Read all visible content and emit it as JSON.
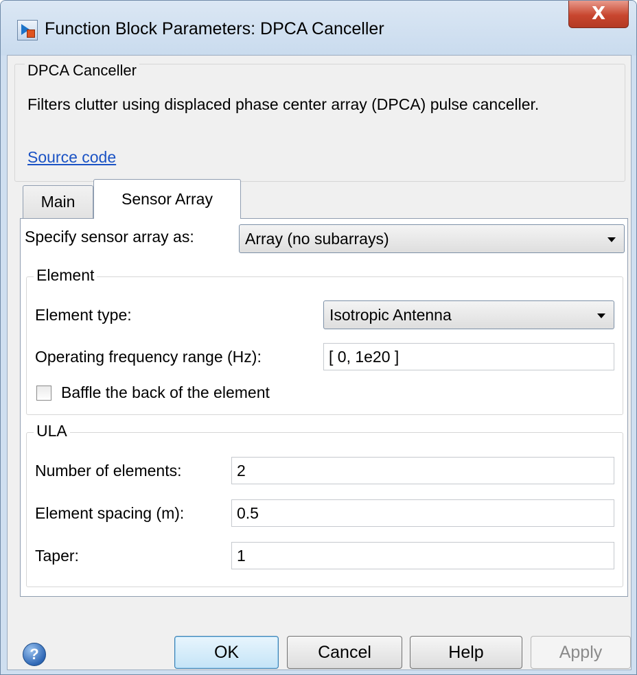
{
  "window": {
    "title": "Function Block Parameters: DPCA Canceller",
    "close_glyph": "X"
  },
  "description": {
    "group_title": "DPCA Canceller",
    "text": "Filters clutter using displaced phase center array (DPCA) pulse canceller.",
    "source_link": "Source code"
  },
  "tabs": [
    {
      "label": "Main",
      "active": false
    },
    {
      "label": "Sensor Array",
      "active": true
    }
  ],
  "sensor_array": {
    "specify_label": "Specify sensor array as:",
    "specify_value": "Array (no subarrays)",
    "element": {
      "group_title": "Element",
      "type_label": "Element type:",
      "type_value": "Isotropic Antenna",
      "freq_label": "Operating frequency range (Hz):",
      "freq_value": "[ 0, 1e20 ]",
      "baffle_label": "Baffle the back of the element",
      "baffle_checked": false
    },
    "ula": {
      "group_title": "ULA",
      "num_elements_label": "Number of elements:",
      "num_elements_value": "2",
      "spacing_label": "Element spacing (m):",
      "spacing_value": "0.5",
      "taper_label": "Taper:",
      "taper_value": "1"
    }
  },
  "buttons": {
    "help_icon_glyph": "?",
    "ok": "OK",
    "cancel": "Cancel",
    "help": "Help",
    "apply": "Apply"
  },
  "colors": {
    "title_bar": "#cfdff0",
    "close_button": "#c8462f",
    "link": "#1a52c4",
    "ok_button": "#c4e4f7"
  }
}
